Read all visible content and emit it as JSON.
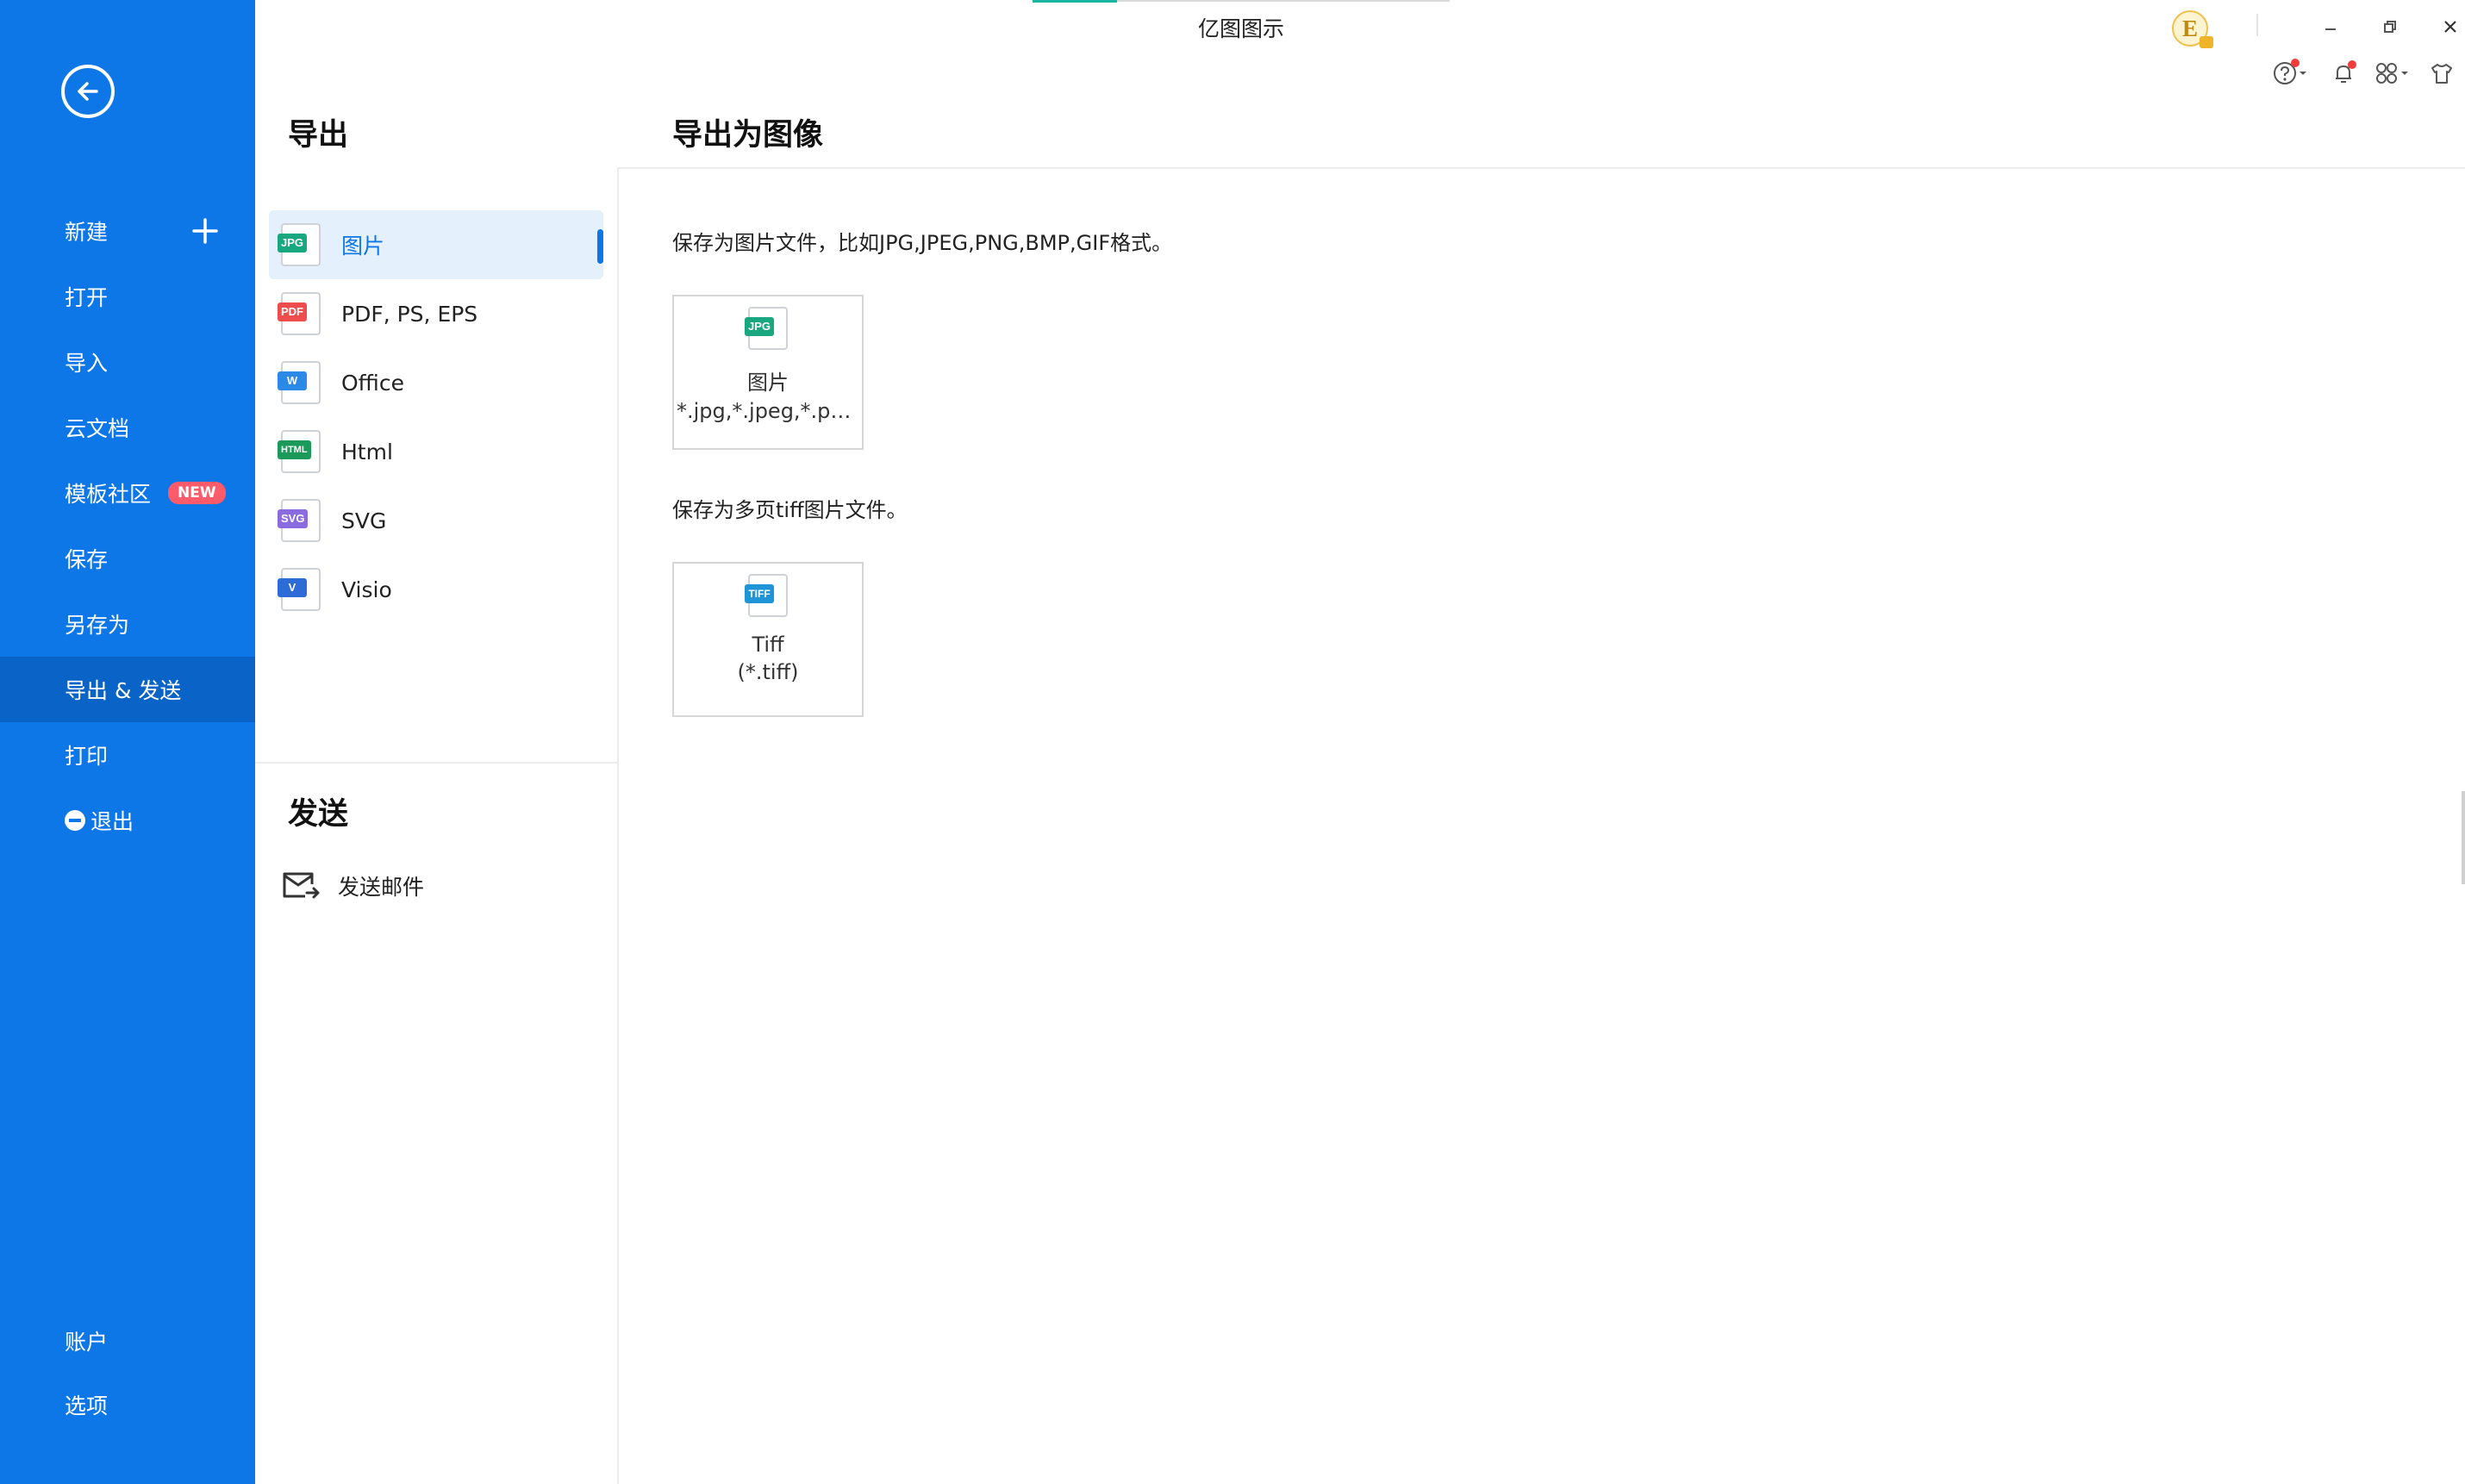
{
  "app": {
    "title": "亿图图示",
    "user_initial": "E"
  },
  "sidebar": {
    "items": [
      {
        "label": "新建"
      },
      {
        "label": "打开"
      },
      {
        "label": "导入"
      },
      {
        "label": "云文档"
      },
      {
        "label": "模板社区",
        "badge": "NEW"
      },
      {
        "label": "保存"
      },
      {
        "label": "另存为"
      },
      {
        "label": "导出 & 发送",
        "active": true
      },
      {
        "label": "打印"
      },
      {
        "label": "退出"
      }
    ],
    "bottom_items": [
      {
        "label": "账户"
      },
      {
        "label": "选项"
      }
    ]
  },
  "export": {
    "title": "导出",
    "formats": [
      {
        "label": "图片",
        "icon": "jpg-file-icon",
        "tag": "JPG",
        "color": "#19a77f",
        "active": true
      },
      {
        "label": "PDF, PS, EPS",
        "icon": "pdf-file-icon",
        "tag": "PDF",
        "color": "#ef4d4d"
      },
      {
        "label": "Office",
        "icon": "word-file-icon",
        "tag": "W",
        "color": "#2b8ae8"
      },
      {
        "label": "Html",
        "icon": "html-file-icon",
        "tag": "HTML",
        "color": "#1c9a5a"
      },
      {
        "label": "SVG",
        "icon": "svg-file-icon",
        "tag": "SVG",
        "color": "#8a6be0"
      },
      {
        "label": "Visio",
        "icon": "visio-file-icon",
        "tag": "V",
        "color": "#2d6cd6"
      }
    ]
  },
  "send": {
    "title": "发送",
    "items": [
      {
        "label": "发送邮件",
        "icon": "mail-send-icon"
      }
    ]
  },
  "content": {
    "title": "导出为图像",
    "image_desc": "保存为图片文件，比如JPG,JPEG,PNG,BMP,GIF格式。",
    "image_card": {
      "name": "图片",
      "ext": "*.jpg,*.jpeg,*.png...",
      "tag": "JPG",
      "color": "#19a77f"
    },
    "tiff_desc": "保存为多页tiff图片文件。",
    "tiff_card": {
      "name": "Tiff",
      "ext": "(*.tiff)",
      "tag": "TIFF",
      "color": "#1f94d6"
    }
  },
  "colors": {
    "sidebar": "#0e77e8",
    "sidebar_active": "#0a63c7",
    "accent": "#0e77e8"
  }
}
